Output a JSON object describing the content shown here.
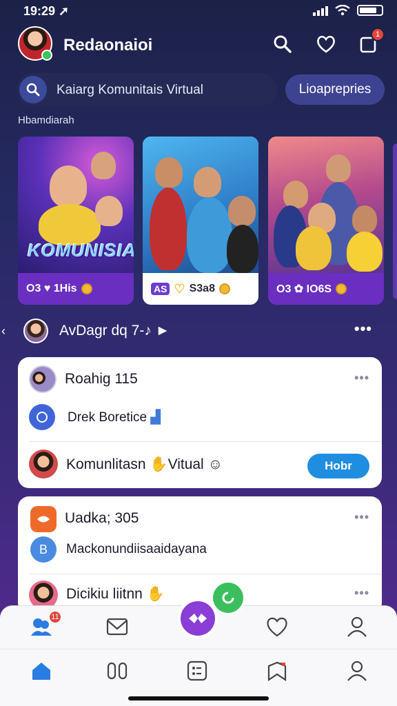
{
  "status": {
    "time": "19:29"
  },
  "header": {
    "title": "Redaonaioi",
    "notification_count": "1"
  },
  "search": {
    "placeholder": "Kaiarg Komunitais Virtual",
    "chip_label": "Lioaprepries"
  },
  "section": {
    "label": "Hbamdiarah"
  },
  "stories": [
    {
      "overlay": "KOMUNISIAS",
      "stats": "O3 ♥ 1His"
    },
    {
      "badge": "AS",
      "stats": "S3a8"
    },
    {
      "stats": "O3 ✿ IO6S"
    }
  ],
  "feed_header": {
    "title": "AvDagr dq 7-♪ ►"
  },
  "posts": [
    {
      "title": "Roahig 115",
      "sub_item": "Drek Boretice",
      "member_name": "Komunlitasn",
      "member_suffix": "Vitual",
      "join_label": "Hobr"
    },
    {
      "title": "Uadka; 305",
      "sub_letter": "B",
      "sub_item": "Mackonundiisaaidayana",
      "member_name": "Dicikiu liitnn"
    }
  ],
  "bottom_nav": {
    "badge": "11"
  },
  "colors": {
    "accent": "#1f8ee0",
    "fab": "#8a3ed6",
    "online": "#3cc45d",
    "badge": "#e0463b"
  }
}
